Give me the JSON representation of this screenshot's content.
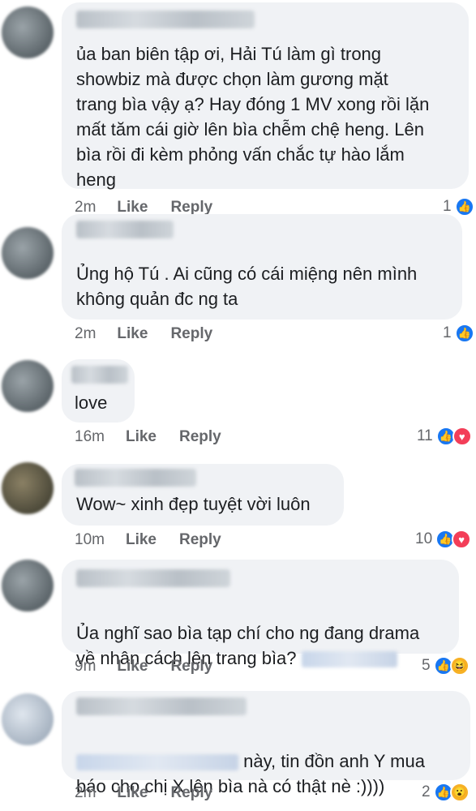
{
  "comments": [
    {
      "text": "ủa ban biên tập ơi, Hải Tú làm gì trong\nshowbiz mà được chọn làm gương mặt\ntrang bìa vậy ạ? Hay đóng 1 MV xong rồi lặn\nmất tăm cái giờ lên bìa chễm chệ heng. Lên\nbìa rồi đi kèm phỏng vấn chắc tự hào lắm\nheng",
      "time": "2m",
      "like_label": "Like",
      "reply_label": "Reply",
      "reaction_count": "1",
      "reactions": [
        "like"
      ]
    },
    {
      "text": "Ủng hộ Tú . Ai cũng có cái miệng nên mình\nkhông quản đc ng ta",
      "time": "2m",
      "like_label": "Like",
      "reply_label": "Reply",
      "reaction_count": "1",
      "reactions": [
        "like"
      ]
    },
    {
      "text": "love",
      "time": "16m",
      "like_label": "Like",
      "reply_label": "Reply",
      "reaction_count": "11",
      "reactions": [
        "like",
        "love"
      ]
    },
    {
      "text": "Wow~ xinh đẹp tuyệt vời luôn",
      "time": "10m",
      "like_label": "Like",
      "reply_label": "Reply",
      "reaction_count": "10",
      "reactions": [
        "like",
        "love"
      ]
    },
    {
      "text_line1": "Ủa nghĩ sao bìa tạp chí cho ng đang drama",
      "text_line2": "về nhân cách lên trang bìa?",
      "time": "9m",
      "like_label": "Like",
      "reply_label": "Reply",
      "reaction_count": "5",
      "reactions": [
        "like",
        "haha"
      ]
    },
    {
      "text_line1": "này, tin đồn anh Y mua",
      "text_line2": "báo cho chị X lên bìa nà có thật nè :))))",
      "time": "2m",
      "like_label": "Like",
      "reply_label": "Reply",
      "reaction_count": "2",
      "reactions": [
        "like",
        "wow"
      ]
    }
  ],
  "icons": {
    "like": "👍",
    "love": "♥",
    "haha": "😆",
    "wow": "😮"
  },
  "colors": {
    "bubble": "#f0f2f5",
    "like": "#1877f2",
    "love": "#f33e58",
    "haha": "#f7b125",
    "meta": "#65676b"
  }
}
